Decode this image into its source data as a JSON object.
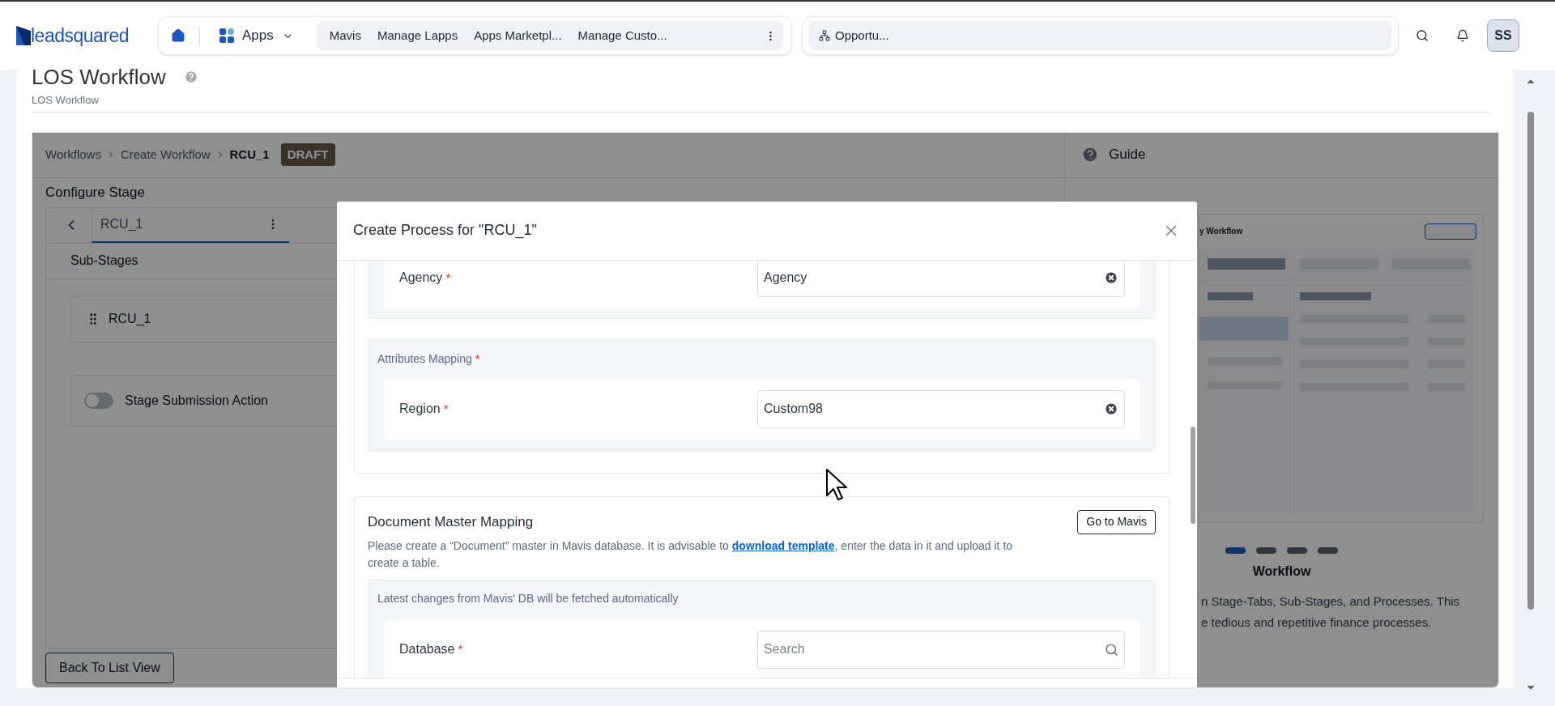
{
  "header": {
    "logo": "leadsquared",
    "apps_label": "Apps",
    "nav_tabs": [
      {
        "label": "Mavis"
      },
      {
        "label": "Manage Lapps"
      },
      {
        "label": "Apps Marketpl..."
      },
      {
        "label": "Manage Custo..."
      }
    ],
    "open_tab": {
      "label": "Opportu..."
    },
    "avatar": "SS"
  },
  "page": {
    "title": "LOS Workflow",
    "subtitle": "LOS Workflow"
  },
  "workflow": {
    "breadcrumb": [
      {
        "label": "Workflows"
      },
      {
        "label": "Create Workflow"
      },
      {
        "label": "RCU_1"
      }
    ],
    "status_badge": "DRAFT",
    "section_title": "Configure Stage",
    "stage_tabs": [
      {
        "label": "RCU_1",
        "selected": true
      }
    ],
    "sub_stages_title": "Sub-Stages",
    "sub_stages": [
      {
        "label": "RCU_1"
      }
    ],
    "submission_toggle": {
      "label": "Stage Submission Action",
      "on": false
    },
    "back_button": "Back To List View"
  },
  "guide": {
    "title": "Guide",
    "illustration_caption": "y Workflow",
    "slides": [
      {
        "selected": true
      },
      {
        "selected": false
      },
      {
        "selected": false
      },
      {
        "selected": false
      }
    ],
    "slide_title": "Workflow",
    "description_lines": [
      "n Stage-Tabs, Sub-Stages, and Processes. This",
      "e tedious and repetitive finance processes."
    ]
  },
  "modal": {
    "title": "Create Process for \"RCU_1\"",
    "agency_row": {
      "label": "Agency",
      "required_mark": "*",
      "value": "Agency"
    },
    "attributes_mapping": {
      "title": "Attributes Mapping",
      "required_mark": "*",
      "rows": [
        {
          "label": "Region",
          "required_mark": "*",
          "value": "Custom98"
        }
      ]
    },
    "document_master": {
      "title": "Document Master Mapping",
      "button": "Go to Mavis",
      "description": {
        "before": "Please create a “Document” master in Mavis database. It is advisable to ",
        "link": "download template",
        "after": ", enter the data in it and upload it to create a table."
      },
      "note": "Latest changes from Mavis' DB will be fetched automatically",
      "rows": [
        {
          "label": "Database",
          "required_mark": "*",
          "placeholder": "Search"
        }
      ]
    }
  }
}
